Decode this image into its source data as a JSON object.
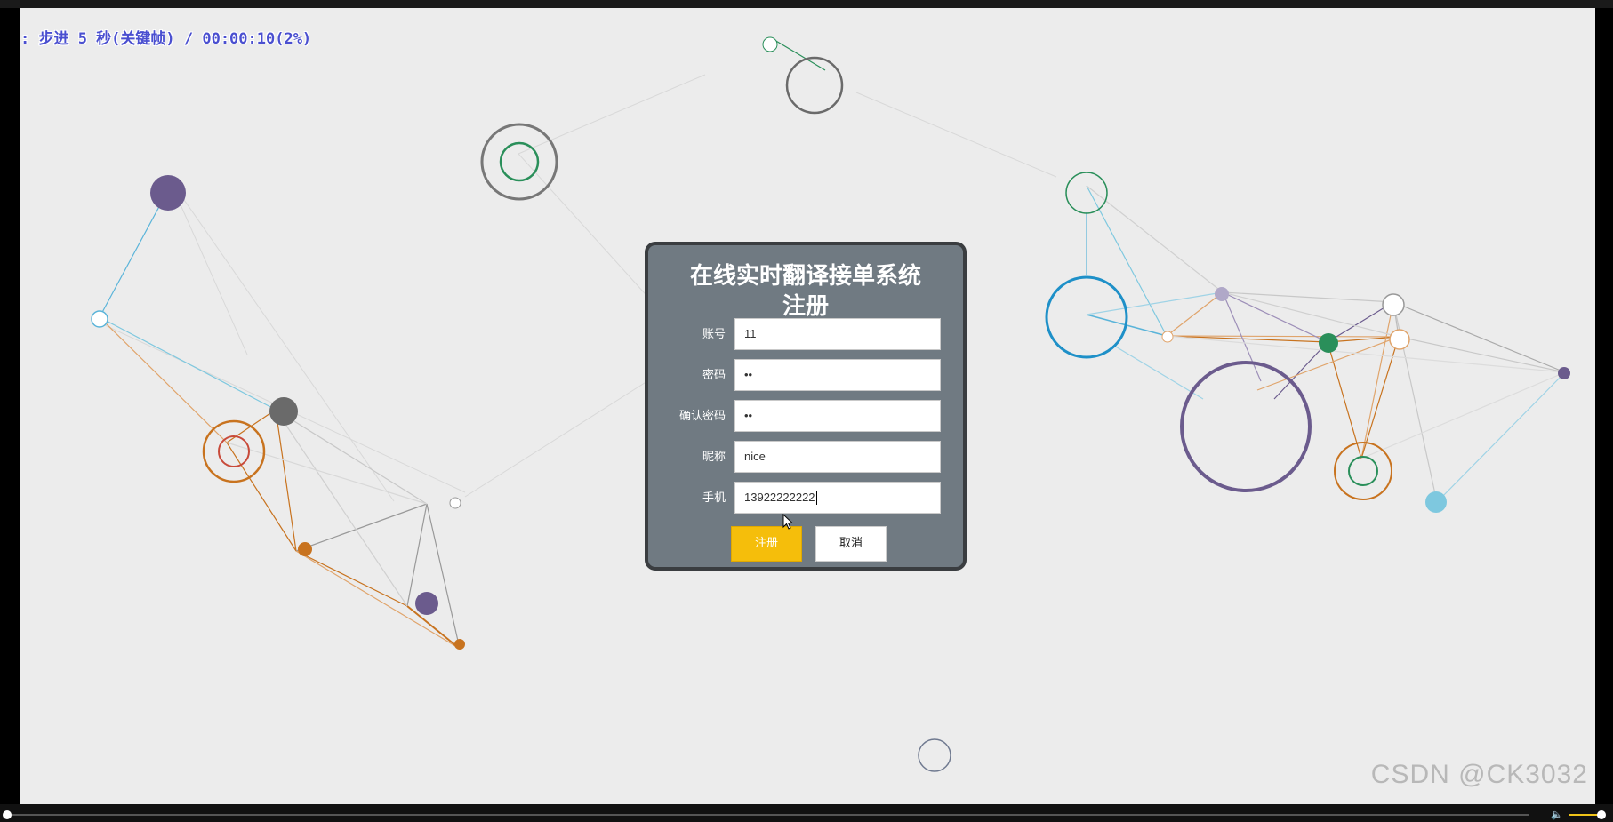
{
  "player": {
    "osd_text": ": 步进 5 秒(关键帧) / 00:00:10(2%)",
    "watermark": "CSDN @CK3032",
    "progress_percent": 2,
    "volume_fraction": 0.9
  },
  "form": {
    "title_line1": "在线实时翻译接单系统",
    "title_line2": "注册",
    "fields": [
      {
        "label": "账号",
        "value": "11"
      },
      {
        "label": "密码",
        "value": "••"
      },
      {
        "label": "确认密码",
        "value": "••"
      },
      {
        "label": "昵称",
        "value": "nice"
      },
      {
        "label": "手机",
        "value": "13922222222"
      }
    ],
    "register_label": "注册",
    "cancel_label": "取消"
  },
  "colors": {
    "page_bg": "#ececec",
    "panel_bg": "#707a82",
    "primary_button": "#f5be0b",
    "purple": "#6b5b8d",
    "orange": "#c8731f",
    "blue": "#1e90c8",
    "green": "#2a8f5a",
    "gray": "#6a6a6a",
    "light_blue": "#7ec8df"
  }
}
